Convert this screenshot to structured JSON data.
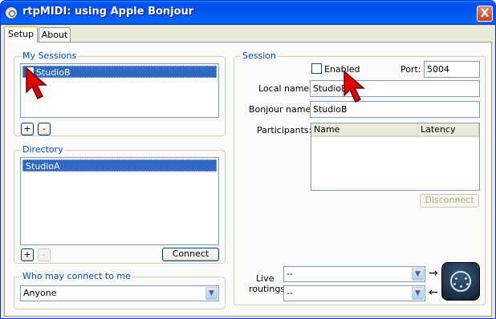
{
  "window": {
    "title": "rtpMIDI: using Apple Bonjour",
    "close_glyph": "X"
  },
  "tabs": [
    {
      "label": "Setup"
    },
    {
      "label": "About"
    }
  ],
  "my_sessions": {
    "title": "My Sessions",
    "items": [
      {
        "label": "StudioB",
        "checked": false
      }
    ],
    "add_label": "+",
    "remove_label": "-"
  },
  "directory": {
    "title": "Directory",
    "items": [
      {
        "label": "StudioA"
      }
    ],
    "add_label": "+",
    "remove_label": "-",
    "connect_label": "Connect"
  },
  "who_may_connect": {
    "title": "Who may connect to me",
    "value": "Anyone"
  },
  "session": {
    "title": "Session",
    "enabled_label": "Enabled",
    "enabled": false,
    "port_label": "Port:",
    "port_value": "5004",
    "local_name_label": "Local name:",
    "local_name_value": "StudioB",
    "bonjour_name_label": "Bonjour name:",
    "bonjour_name_value": "StudioB",
    "participants_label": "Participants:",
    "participants_columns": [
      "Name",
      "Latency"
    ],
    "disconnect_label": "Disconnect"
  },
  "live_routings": {
    "label_line1": "Live",
    "label_line2": "routings",
    "in_value": "--",
    "out_value": "--",
    "arrow_right": "→",
    "arrow_left": "←"
  },
  "logo": {
    "text": "<··>",
    "accent": "#1D3A5C"
  },
  "colors": {
    "title_bar": "#0054E3",
    "selection": "#316AC5",
    "group_label": "#0046D5",
    "cursor": "#E00000"
  }
}
